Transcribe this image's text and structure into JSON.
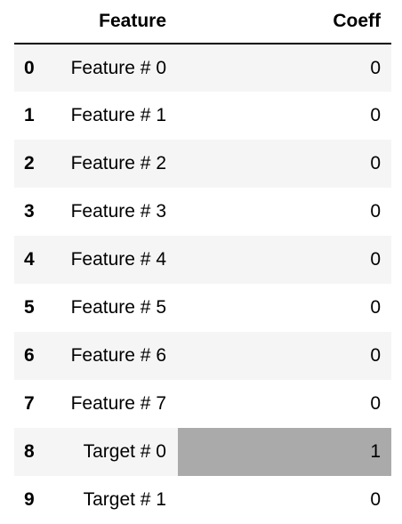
{
  "table": {
    "headers": {
      "index": "",
      "feature": "Feature",
      "coeff": "Coeff"
    },
    "highlight_color": "#aaaaaa",
    "rows": [
      {
        "index": "0",
        "feature": "Feature # 0",
        "coeff": "0",
        "highlighted": false
      },
      {
        "index": "1",
        "feature": "Feature # 1",
        "coeff": "0",
        "highlighted": false
      },
      {
        "index": "2",
        "feature": "Feature # 2",
        "coeff": "0",
        "highlighted": false
      },
      {
        "index": "3",
        "feature": "Feature # 3",
        "coeff": "0",
        "highlighted": false
      },
      {
        "index": "4",
        "feature": "Feature # 4",
        "coeff": "0",
        "highlighted": false
      },
      {
        "index": "5",
        "feature": "Feature # 5",
        "coeff": "0",
        "highlighted": false
      },
      {
        "index": "6",
        "feature": "Feature # 6",
        "coeff": "0",
        "highlighted": false
      },
      {
        "index": "7",
        "feature": "Feature # 7",
        "coeff": "0",
        "highlighted": false
      },
      {
        "index": "8",
        "feature": "Target # 0",
        "coeff": "1",
        "highlighted": true
      },
      {
        "index": "9",
        "feature": "Target # 1",
        "coeff": "0",
        "highlighted": false
      }
    ]
  }
}
